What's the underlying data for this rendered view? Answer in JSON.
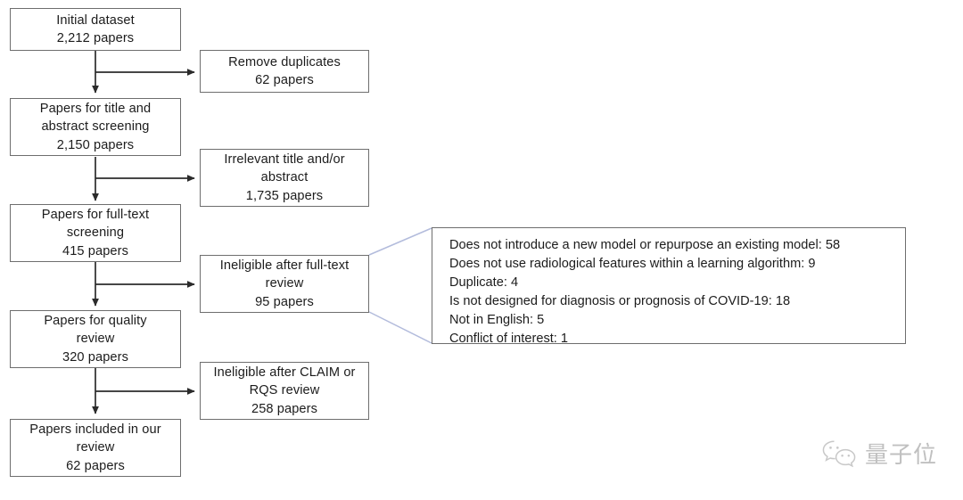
{
  "diagram": {
    "title": "PRISMA-style study selection flowchart",
    "stroke_color": "#6e6e6e",
    "arrow_color": "#2b2b2b",
    "connector_color": "#b3bcdc",
    "main_flow": [
      {
        "id": "initial-dataset",
        "lines": [
          "Initial dataset",
          "2,212 papers"
        ],
        "label": "Initial dataset",
        "count": "2,212 papers"
      },
      {
        "id": "title-abstract-screening",
        "lines": [
          "Papers for title and",
          "abstract screening",
          "2,150 papers"
        ],
        "label": "Papers for title and abstract screening",
        "count": "2,150 papers"
      },
      {
        "id": "full-text-screening",
        "lines": [
          "Papers for full-text",
          "screening",
          "415 papers"
        ],
        "label": "Papers for full-text screening",
        "count": "415 papers"
      },
      {
        "id": "quality-review",
        "lines": [
          "Papers for quality",
          "review",
          "320 papers"
        ],
        "label": "Papers for quality review",
        "count": "320 papers"
      },
      {
        "id": "included-in-review",
        "lines": [
          "Papers included in our",
          "review",
          "62 papers"
        ],
        "label": "Papers included in our review",
        "count": "62 papers"
      }
    ],
    "exclusions": [
      {
        "id": "remove-duplicates",
        "lines": [
          "Remove duplicates",
          "62 papers"
        ],
        "label": "Remove duplicates",
        "count": "62 papers"
      },
      {
        "id": "irrelevant-title-abstract",
        "lines": [
          "Irrelevant title and/or",
          "abstract",
          "1,735 papers"
        ],
        "label": "Irrelevant title and/or abstract",
        "count": "1,735 papers"
      },
      {
        "id": "ineligible-full-text",
        "lines": [
          "Ineligible after full-text",
          "review",
          "95 papers"
        ],
        "label": "Ineligible after full-text review",
        "count": "95 papers"
      },
      {
        "id": "ineligible-claim-rqs",
        "lines": [
          "Ineligible after CLAIM or",
          "RQS review",
          "258 papers"
        ],
        "label": "Ineligible after CLAIM or RQS review",
        "count": "258 papers"
      }
    ],
    "callout": {
      "source_node": "ineligible-full-text",
      "lines": [
        "Does not introduce a new model or repurpose an existing model: 58",
        "Does not use radiological features within a learning algorithm: 9",
        "Duplicate: 4",
        "Is not designed for diagnosis or prognosis of COVID-19: 18",
        "Not in English: 5",
        "Conflict of interest: 1"
      ],
      "reasons": [
        {
          "reason": "Does not introduce a new model or repurpose an existing model",
          "count": 58
        },
        {
          "reason": "Does not use radiological features within a learning algorithm",
          "count": 9
        },
        {
          "reason": "Duplicate",
          "count": 4
        },
        {
          "reason": "Is not designed for diagnosis or prognosis of COVID-19",
          "count": 18
        },
        {
          "reason": "Not in English",
          "count": 5
        },
        {
          "reason": "Conflict of interest",
          "count": 1
        }
      ]
    }
  },
  "watermark": {
    "text": "量子位",
    "icon": "wechat-icon",
    "color": "#9a9a9a"
  }
}
